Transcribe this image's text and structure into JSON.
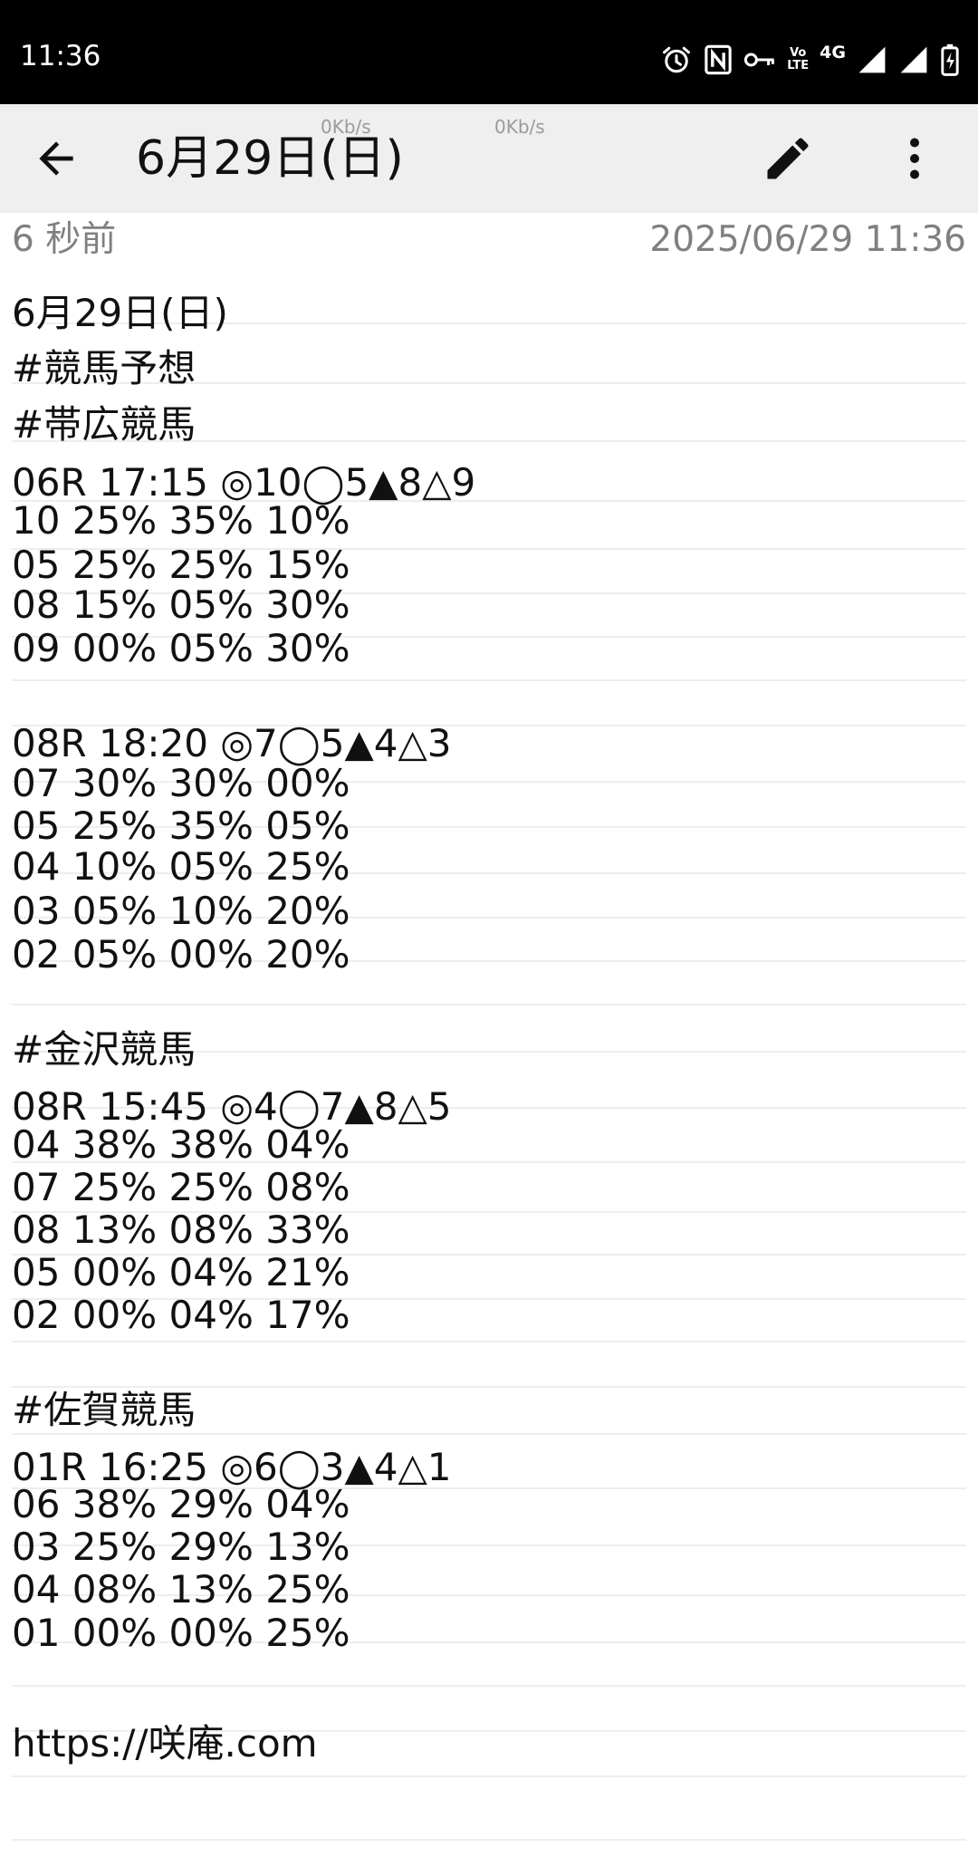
{
  "status_bar": {
    "time": "11:36",
    "network": "4G",
    "volte_top": "Vo",
    "volte_bottom": "LTE",
    "icons": [
      "alarm-icon",
      "nfc-icon",
      "vpn-key-icon",
      "volte-icon",
      "signal-icon",
      "signal-icon",
      "battery-charging-icon"
    ]
  },
  "toolbar": {
    "title": "6月29日(日)",
    "speed_left": "0Kb/s",
    "speed_right": "0Kb/s",
    "icons": [
      "back-arrow-icon",
      "pencil-icon",
      "more-vert-icon"
    ]
  },
  "meta": {
    "relative_time": "6 秒前",
    "timestamp": "2025/06/29 11:36"
  },
  "note_lines": [
    "6月29日(日)",
    "#競馬予想",
    "#帯広競馬",
    "06R 17:15 ◎10◯5▲8△9",
    "10 25% 35% 10%",
    "05 25% 25% 15%",
    "08 15% 05% 30%",
    "09 00% 05% 30%",
    "",
    "08R 18:20 ◎7◯5▲4△3",
    "07 30% 30% 00%",
    "05 25% 35% 05%",
    "04 10% 05% 25%",
    "03 05% 10% 20%",
    "02 05% 00% 20%",
    "",
    "#金沢競馬",
    "08R 15:45 ◎4◯7▲8△5",
    "04 38% 38% 04%",
    "07 25% 25% 08%",
    "08 13% 08% 33%",
    "05 00% 04% 21%",
    "02 00% 04% 17%",
    "",
    "#佐賀競馬",
    "01R 16:25 ◎6◯3▲4△1",
    "06 38% 29% 04%",
    "03 25% 29% 13%",
    "04 08% 13% 25%",
    "01 00% 00% 25%",
    "",
    "https://咲庵.com"
  ]
}
